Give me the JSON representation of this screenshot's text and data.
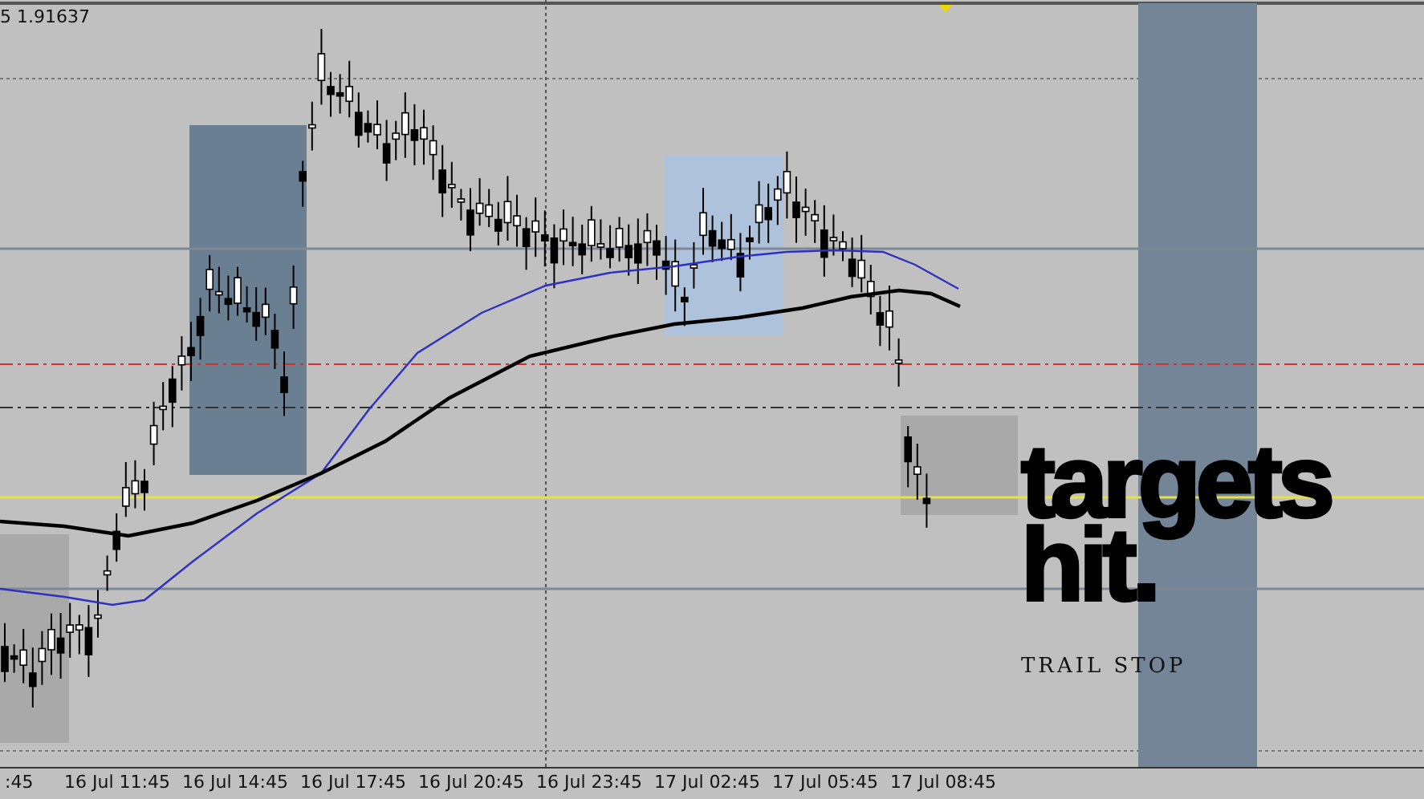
{
  "chart": {
    "price_label": "5 1.91637",
    "time_axis": [
      ":45",
      "16 Jul 11:45",
      "16 Jul 14:45",
      "16 Jul 17:45",
      "16 Jul 20:45",
      "16 Jul 23:45",
      "17 Jul 02:45",
      "17 Jul 05:45",
      "17 Jul 08:45"
    ]
  },
  "overlay": {
    "headline": [
      "targets",
      "hit."
    ],
    "subtitle": "TRAIL STOP"
  }
}
